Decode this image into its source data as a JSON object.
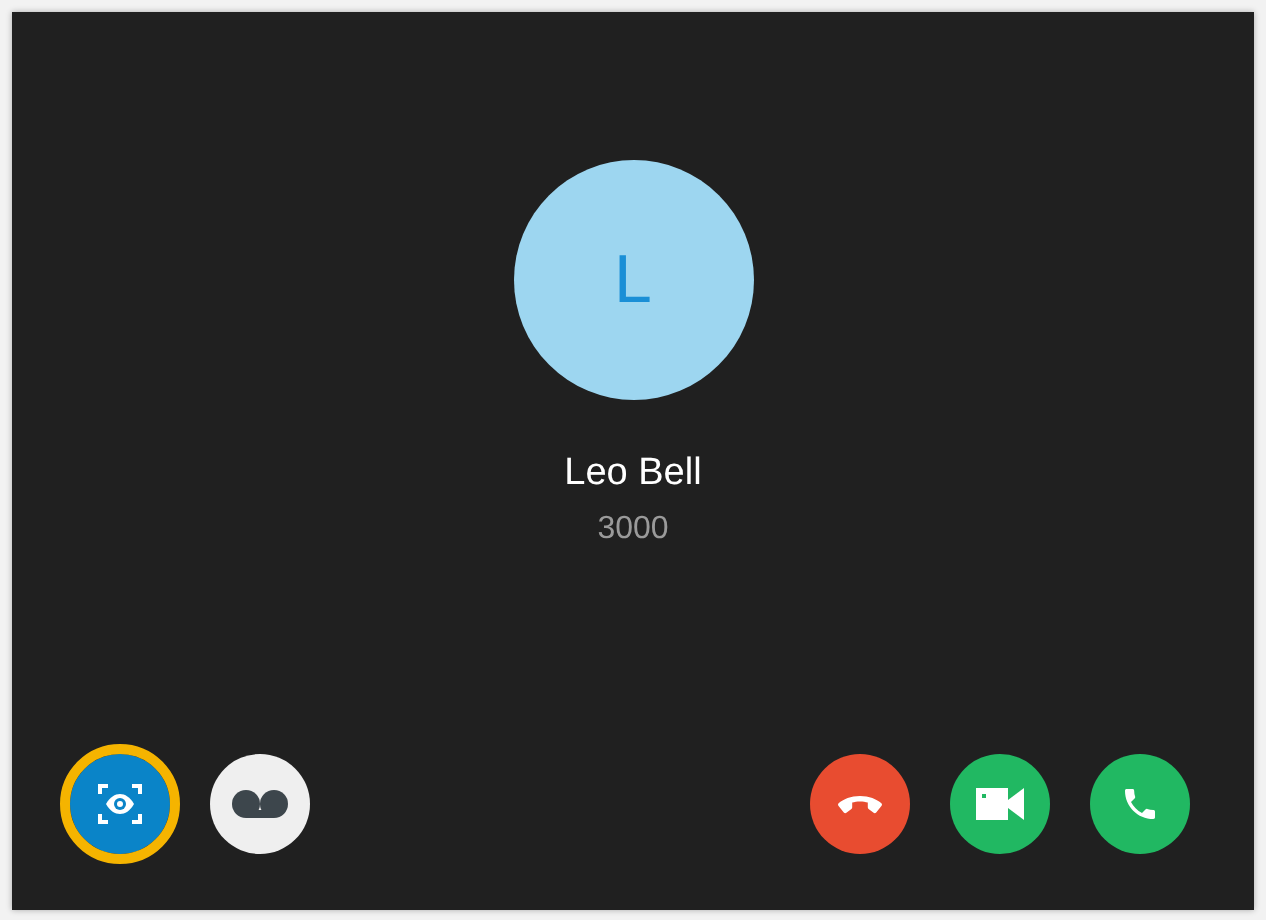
{
  "contact": {
    "initial": "L",
    "name": "Leo Bell",
    "number": "3000"
  },
  "left_actions": [
    {
      "kind": "scan",
      "highlighted": true
    },
    {
      "kind": "voicemail",
      "highlighted": false
    }
  ],
  "right_actions": [
    {
      "kind": "hangup"
    },
    {
      "kind": "video"
    },
    {
      "kind": "call"
    }
  ]
}
